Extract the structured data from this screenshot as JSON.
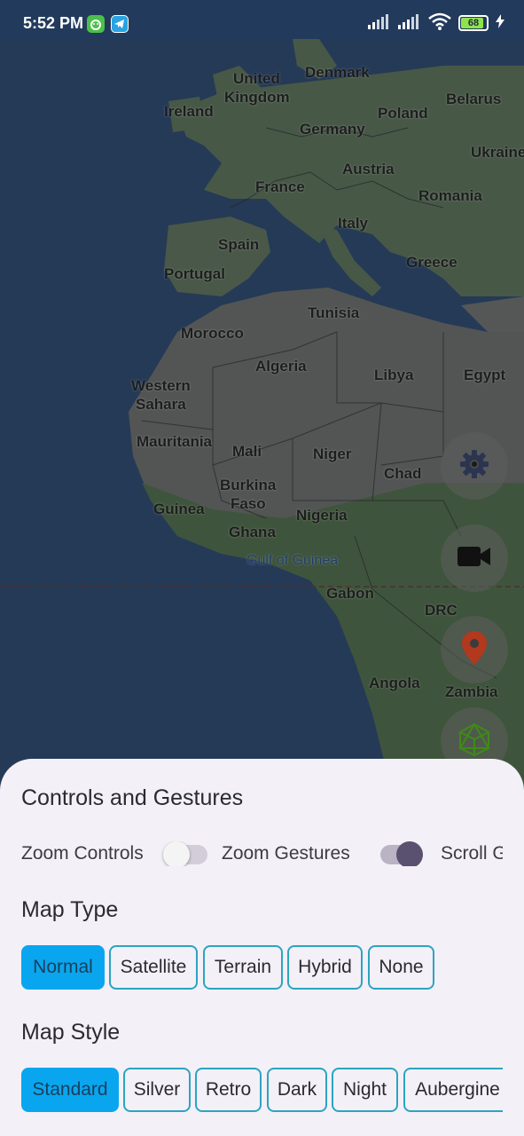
{
  "status_bar": {
    "time": "5:52 PM",
    "battery": "68",
    "icons": [
      "android-app-icon",
      "telegram-icon",
      "signal-icon",
      "signal-icon",
      "wifi-icon",
      "battery-icon",
      "charging-icon"
    ]
  },
  "map": {
    "labels": {
      "united_kingdom_1": "United",
      "united_kingdom_2": "Kingdom",
      "denmark": "Denmark",
      "ireland": "Ireland",
      "belarus": "Belarus",
      "poland": "Poland",
      "germany": "Germany",
      "ukraine": "Ukraine",
      "austria": "Austria",
      "france": "France",
      "romania": "Romania",
      "italy": "Italy",
      "spain": "Spain",
      "portugal": "Portugal",
      "greece": "Greece",
      "tunisia": "Tunisia",
      "morocco": "Morocco",
      "algeria": "Algeria",
      "libya": "Libya",
      "egypt": "Egypt",
      "western_sahara_1": "Western",
      "western_sahara_2": "Sahara",
      "mauritania": "Mauritania",
      "mali": "Mali",
      "niger": "Niger",
      "chad": "Chad",
      "burkina_faso_1": "Burkina",
      "burkina_faso_2": "Faso",
      "guinea": "Guinea",
      "nigeria": "Nigeria",
      "ghana": "Ghana",
      "gulf_of_guinea": "Gulf of Guinea",
      "gabon": "Gabon",
      "drc": "DRC",
      "angola": "Angola",
      "zambia": "Zambia"
    }
  },
  "fabs": {
    "settings": "gear-icon",
    "camera": "video-camera-icon",
    "marker": "location-pin-icon",
    "shapes": "3d-cube-icon"
  },
  "sheet": {
    "controls_title": "Controls and Gestures",
    "toggles": {
      "zoom_controls": {
        "label": "Zoom Controls",
        "on": false
      },
      "zoom_gestures": {
        "label": "Zoom Gestures",
        "on": true
      },
      "scroll_gestures": {
        "label": "Scroll G"
      }
    },
    "map_type_title": "Map Type",
    "map_types": [
      "Normal",
      "Satellite",
      "Terrain",
      "Hybrid",
      "None"
    ],
    "map_type_selected": "Normal",
    "map_style_title": "Map Style",
    "map_styles": [
      "Standard",
      "Silver",
      "Retro",
      "Dark",
      "Night",
      "Aubergine"
    ],
    "map_style_selected": "Standard"
  },
  "colors": {
    "accent_selected": "#09a6ef",
    "chip_border": "#2aa5c0",
    "sheet_bg": "#f4f0f7",
    "marker_red": "#b2381e",
    "cube_green": "#3f8a17"
  }
}
